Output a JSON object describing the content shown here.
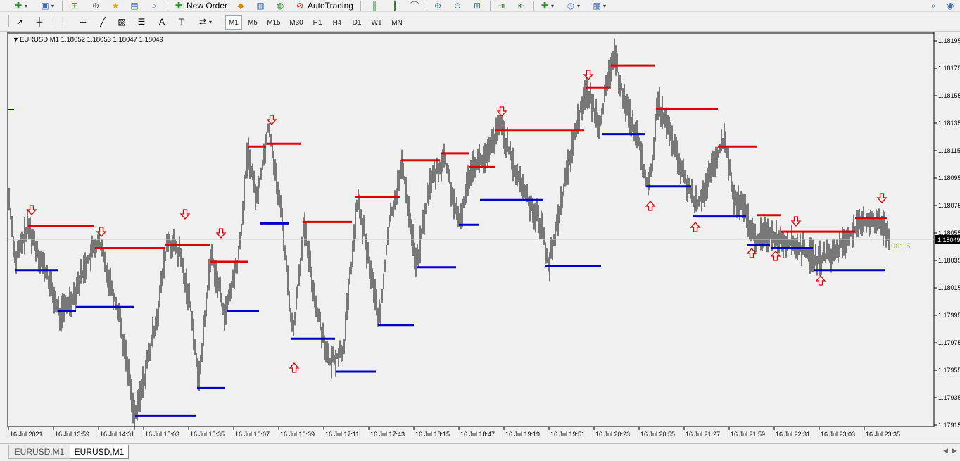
{
  "toolbar1": {
    "new_order_label": "New Order",
    "autotrading_label": "AutoTrading"
  },
  "toolbar2": {
    "timeframes": [
      "M1",
      "M5",
      "M15",
      "M30",
      "H1",
      "H4",
      "D1",
      "W1",
      "MN"
    ],
    "active_timeframe": "M1"
  },
  "chart": {
    "header_text": "EURUSD,M1  1.18052 1.18053 1.18047 1.18049",
    "current_price_label": "1.18049",
    "countdown": "00:15",
    "price_ticks": [
      "1.18195",
      "1.18175",
      "1.18155",
      "1.18135",
      "1.18115",
      "1.18095",
      "1.18075",
      "1.18055",
      "1.18035",
      "1.18015",
      "1.17995",
      "1.17975",
      "1.17955",
      "1.17935",
      "1.17915"
    ],
    "time_ticks": [
      "16 Jul 2021",
      "16 Jul 13:59",
      "16 Jul 14:31",
      "16 Jul 15:03",
      "16 Jul 15:35",
      "16 Jul 16:07",
      "16 Jul 16:39",
      "16 Jul 17:11",
      "16 Jul 17:43",
      "16 Jul 18:15",
      "16 Jul 18:47",
      "16 Jul 19:19",
      "16 Jul 19:51",
      "16 Jul 20:23",
      "16 Jul 20:55",
      "16 Jul 21:27",
      "16 Jul 21:59",
      "16 Jul 22:31",
      "16 Jul 23:03",
      "16 Jul 23:35"
    ],
    "colors": {
      "resistance": "#e00000",
      "support": "#0000cc",
      "bars": "#000000",
      "arrow": "#e00000",
      "background": "#f0f0f0",
      "countdown": "#9acd32"
    }
  },
  "tabs": [
    "EURUSD,M1",
    "EURUSD,M1"
  ],
  "active_tab": 1
}
